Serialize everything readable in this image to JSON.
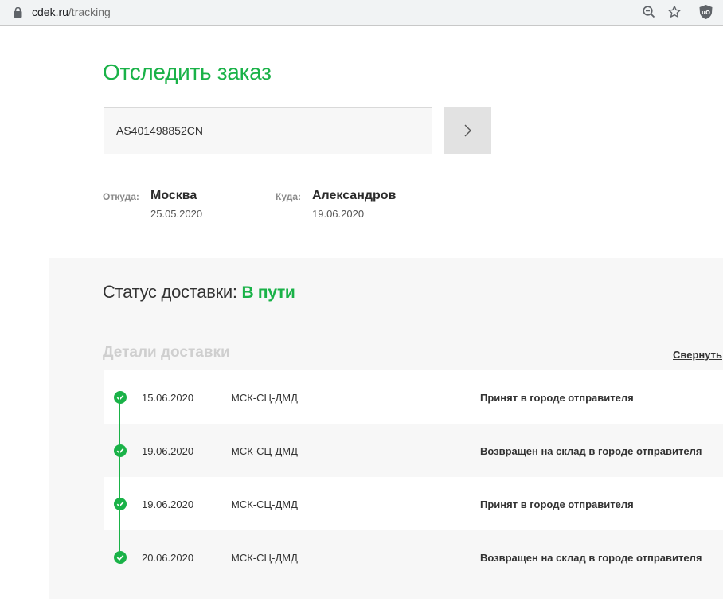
{
  "browser": {
    "url_host": "cdek.ru",
    "url_path": "/tracking",
    "icons": [
      "lock-icon",
      "zoom-icon",
      "star-icon",
      "extension-icon"
    ]
  },
  "page": {
    "title": "Отследить заказ"
  },
  "search": {
    "value": "AS401498852CN",
    "button_icon": "chevron-right-icon"
  },
  "route": {
    "from_label": "Откуда:",
    "from_city": "Москва",
    "from_date": "25.05.2020",
    "to_label": "Куда:",
    "to_city": "Александров",
    "to_date": "19.06.2020"
  },
  "status": {
    "label": "Статус доставки:",
    "value": "В пути"
  },
  "details": {
    "title": "Детали доставки",
    "collapse_label": "Свернуть",
    "events": [
      {
        "date": "15.06.2020",
        "place": "МСК-СЦ-ДМД",
        "status": "Принят в городе отправителя"
      },
      {
        "date": "19.06.2020",
        "place": "МСК-СЦ-ДМД",
        "status": "Возвращен на склад в городе отправителя"
      },
      {
        "date": "19.06.2020",
        "place": "МСК-СЦ-ДМД",
        "status": "Принят в городе отправителя"
      },
      {
        "date": "20.06.2020",
        "place": "МСК-СЦ-ДМД",
        "status": "Возвращен на склад в городе отправителя"
      }
    ]
  },
  "colors": {
    "accent_green": "#1ab248",
    "panel_bg": "#f7f7f7",
    "muted_title": "#cfcfcf"
  }
}
